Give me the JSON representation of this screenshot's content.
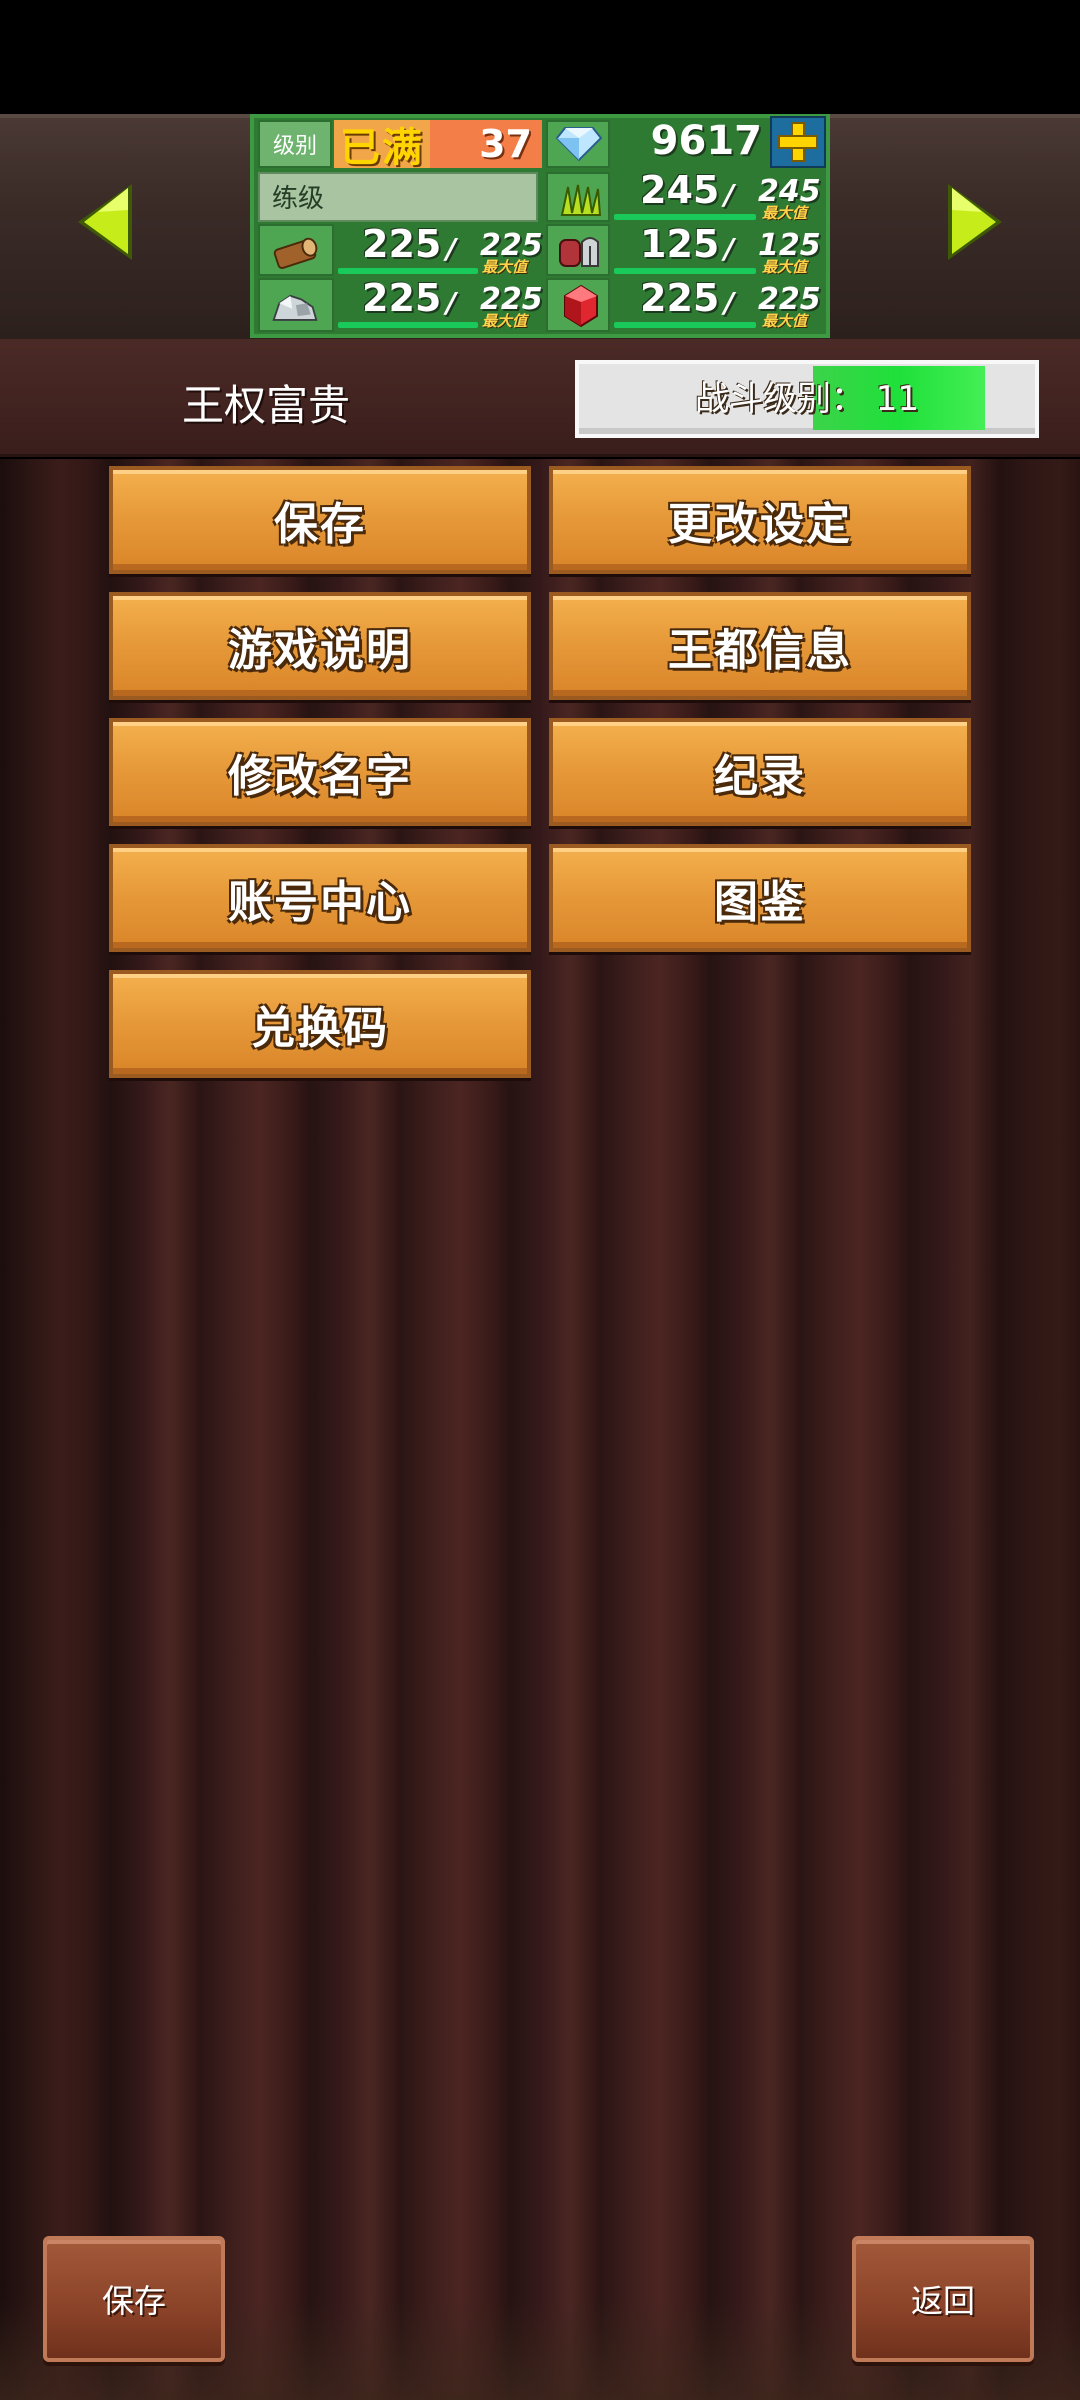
{
  "resources": {
    "level_label": "级别",
    "level_status": "已满",
    "level_value": "37",
    "gems": "9617",
    "training_label": "练级",
    "max_label": "最大值",
    "rows": [
      {
        "name": "wood",
        "icon": "wood-log-icon",
        "value": "225",
        "max": "225",
        "fill": 1.0
      },
      {
        "name": "grass",
        "icon": "grass-icon",
        "value": "245",
        "max": "245",
        "fill": 1.0
      },
      {
        "name": "food",
        "icon": "meat-icon",
        "value": "125",
        "max": "125",
        "fill": 1.0
      },
      {
        "name": "stone",
        "icon": "ore-icon",
        "value": "225",
        "max": "225",
        "fill": 1.0
      },
      {
        "name": "crystal",
        "icon": "red-gem-icon",
        "value": "225",
        "max": "225",
        "fill": 1.0
      }
    ]
  },
  "header": {
    "kingdom_name": "王权富贵",
    "battle_label": "战斗级别：",
    "battle_level": "11",
    "battle_text": "战斗级别： 11"
  },
  "menu": {
    "save": "保存",
    "settings": "更改设定",
    "help": "游戏说明",
    "capital_info": "王都信息",
    "rename": "修改名字",
    "records": "纪录",
    "account": "账号中心",
    "encyclopedia": "图鉴",
    "redeem": "兑换码"
  },
  "footer": {
    "save": "保存",
    "back": "返回"
  },
  "colors": {
    "menu_button": "#e79a3a",
    "panel_green": "#2f7a33",
    "battle_fill": "#1fe03a",
    "arrow": "#c6ec1a"
  }
}
